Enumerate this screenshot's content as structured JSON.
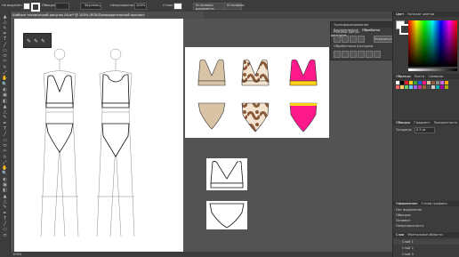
{
  "control_bar": {
    "selection_label": "Не выделен",
    "stroke_label": "Обводка:",
    "stroke_value": "",
    "brush_label": "Заусенец",
    "opacity_label": "Непрозрачность:",
    "opacity_value": "100%",
    "style_label": "Стиль:",
    "doc_settings_label": "Установки документа",
    "prefs_label": "Установки"
  },
  "tabs": [
    {
      "label": "Шаблон технический рисунок A4.ai* @ 100% (RGB/Предварительный просмотр)",
      "active": true
    },
    {
      "label": "",
      "active": false
    }
  ],
  "pathfinder": {
    "tabs": [
      "Трансформирование",
      "Выравнивание",
      "Обработка контуров"
    ],
    "section1": "Режимы фигур:",
    "section2": "Обработчики контуров:",
    "expand_button": "Развернуть"
  },
  "color_panel": {
    "tabs": [
      "Цвет",
      "Каталог цветов"
    ]
  },
  "swatches_panel": {
    "tabs": [
      "Образцы",
      "Кисти",
      "Символы"
    ]
  },
  "stroke_panel": {
    "tabs": [
      "Обводка",
      "Градиент",
      "Прозрачность"
    ],
    "weight_label": "Толщина:",
    "weight_value": "0,5 pt"
  },
  "appearance_panel": {
    "tabs": [
      "Оформление",
      "Стили графики"
    ],
    "title": "Нет выделения",
    "rows": [
      "Обводка:",
      "Заливка:",
      "Непрозрачность:"
    ]
  },
  "layers_panel": {
    "tabs": [
      "Слои",
      "Монтажные области"
    ],
    "layers": [
      "Слой 1",
      "Слой 2",
      "Слой 3"
    ]
  },
  "garment_colors": {
    "beige": "#d8c3a5",
    "brown": "#8a5a3a",
    "magenta": "#ff1a8c",
    "yellow": "#ffd21a"
  },
  "status": {
    "zoom": "100%"
  }
}
